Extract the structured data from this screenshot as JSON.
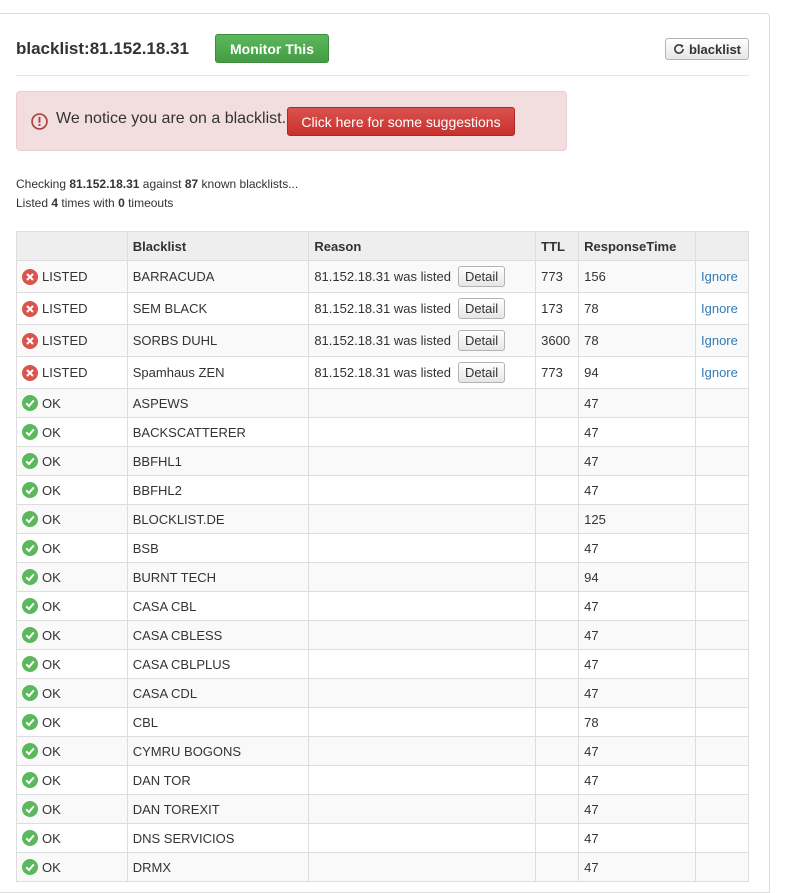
{
  "header": {
    "title": "blacklist:81.152.18.31",
    "monitor_label": "Monitor This",
    "refresh_label": "blacklist"
  },
  "alert": {
    "text": "We notice you are on a blacklist.",
    "button_label": "Click here for some suggestions"
  },
  "summary": {
    "line1_prefix": "Checking ",
    "ip": "81.152.18.31",
    "line1_mid": " against ",
    "count": "87",
    "line1_suffix": " known blacklists...",
    "line2_prefix": "Listed ",
    "listed_times": "4",
    "line2_mid": " times with ",
    "timeouts": "0",
    "line2_suffix": " timeouts"
  },
  "table": {
    "headers": [
      "",
      "Blacklist",
      "Reason",
      "TTL",
      "ResponseTime",
      ""
    ],
    "detail_label": "Detail",
    "ignore_label": "Ignore",
    "listed_rows": [
      {
        "status": "LISTED",
        "blacklist": "BARRACUDA",
        "reason": "81.152.18.31 was listed",
        "ttl": "773",
        "response": "156"
      },
      {
        "status": "LISTED",
        "blacklist": "SEM BLACK",
        "reason": "81.152.18.31 was listed",
        "ttl": "173",
        "response": "78"
      },
      {
        "status": "LISTED",
        "blacklist": "SORBS DUHL",
        "reason": "81.152.18.31 was listed",
        "ttl": "3600",
        "response": "78"
      },
      {
        "status": "LISTED",
        "blacklist": "Spamhaus ZEN",
        "reason": "81.152.18.31 was listed",
        "ttl": "773",
        "response": "94"
      }
    ],
    "ok_rows": [
      {
        "status": "OK",
        "blacklist": "ASPEWS",
        "response": "47"
      },
      {
        "status": "OK",
        "blacklist": "BACKSCATTERER",
        "response": "47"
      },
      {
        "status": "OK",
        "blacklist": "BBFHL1",
        "response": "47"
      },
      {
        "status": "OK",
        "blacklist": "BBFHL2",
        "response": "47"
      },
      {
        "status": "OK",
        "blacklist": "BLOCKLIST.DE",
        "response": "125"
      },
      {
        "status": "OK",
        "blacklist": "BSB",
        "response": "47"
      },
      {
        "status": "OK",
        "blacklist": "BURNT TECH",
        "response": "94"
      },
      {
        "status": "OK",
        "blacklist": "CASA CBL",
        "response": "47"
      },
      {
        "status": "OK",
        "blacklist": "CASA CBLESS",
        "response": "47"
      },
      {
        "status": "OK",
        "blacklist": "CASA CBLPLUS",
        "response": "47"
      },
      {
        "status": "OK",
        "blacklist": "CASA CDL",
        "response": "47"
      },
      {
        "status": "OK",
        "blacklist": "CBL",
        "response": "78"
      },
      {
        "status": "OK",
        "blacklist": "CYMRU BOGONS",
        "response": "47"
      },
      {
        "status": "OK",
        "blacklist": "DAN TOR",
        "response": "47"
      },
      {
        "status": "OK",
        "blacklist": "DAN TOREXIT",
        "response": "47"
      },
      {
        "status": "OK",
        "blacklist": "DNS SERVICIOS",
        "response": "47"
      },
      {
        "status": "OK",
        "blacklist": "DRMX",
        "response": "47"
      }
    ]
  },
  "colors": {
    "ok_green": "#5cb85c",
    "listed_red": "#d9534f",
    "alert_bg": "#f2dede",
    "link_blue": "#337ab7"
  }
}
